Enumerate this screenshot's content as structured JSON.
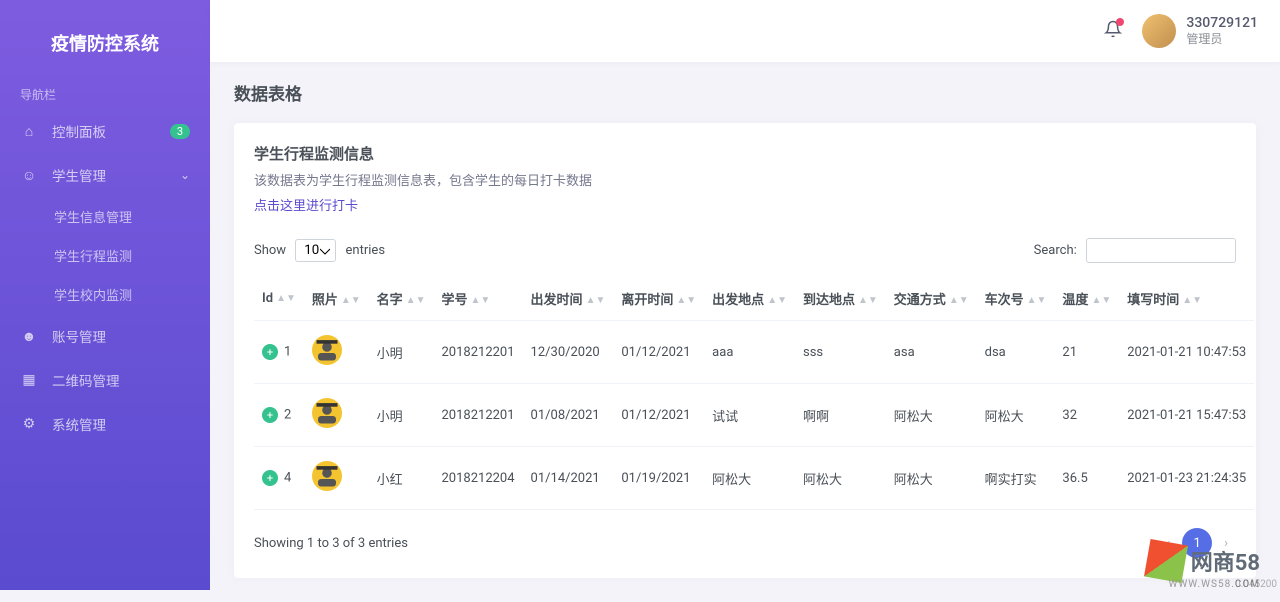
{
  "app": {
    "title": "疫情防控系统"
  },
  "sidebar": {
    "section": "导航栏",
    "items": [
      {
        "label": "控制面板",
        "badge": "3"
      },
      {
        "label": "学生管理",
        "children": [
          "学生信息管理",
          "学生行程监测",
          "学生校内监测"
        ]
      },
      {
        "label": "账号管理"
      },
      {
        "label": "二维码管理"
      },
      {
        "label": "系统管理"
      }
    ]
  },
  "header": {
    "user_id": "330729121",
    "user_role": "管理员"
  },
  "page": {
    "title": "数据表格",
    "card_title": "学生行程监测信息",
    "card_sub": "该数据表为学生行程监测信息表，包含学生的每日打卡数据",
    "card_link": "点击这里进行打卡",
    "show_label": "Show",
    "entries_label": "entries",
    "entries_value": "10",
    "search_label": "Search:",
    "columns": [
      "Id",
      "照片",
      "名字",
      "学号",
      "出发时间",
      "离开时间",
      "出发地点",
      "到达地点",
      "交通方式",
      "车次号",
      "温度",
      "填写时间"
    ],
    "rows": [
      {
        "id": "1",
        "name": "小明",
        "sid": "2018212201",
        "depart": "12/30/2020",
        "leave": "01/12/2021",
        "from": "aaa",
        "to": "sss",
        "mode": "asa",
        "train": "dsa",
        "temp": "21",
        "time": "2021-01-21 10:47:53"
      },
      {
        "id": "2",
        "name": "小明",
        "sid": "2018212201",
        "depart": "01/08/2021",
        "leave": "01/12/2021",
        "from": "试试",
        "to": "啊啊",
        "mode": "阿松大",
        "train": "阿松大",
        "temp": "32",
        "time": "2021-01-21 15:47:53"
      },
      {
        "id": "4",
        "name": "小红",
        "sid": "2018212204",
        "depart": "01/14/2021",
        "leave": "01/19/2021",
        "from": "阿松大",
        "to": "阿松大",
        "mode": "阿松大",
        "train": "啊实打实",
        "temp": "36.5",
        "time": "2021-01-23 21:24:35"
      }
    ],
    "info": "Showing 1 to 3 of 3 entries",
    "page": "1"
  },
  "watermark": {
    "text": "网商58",
    "url": "WWW.WS58.COM",
    "ts": "0.045200"
  }
}
